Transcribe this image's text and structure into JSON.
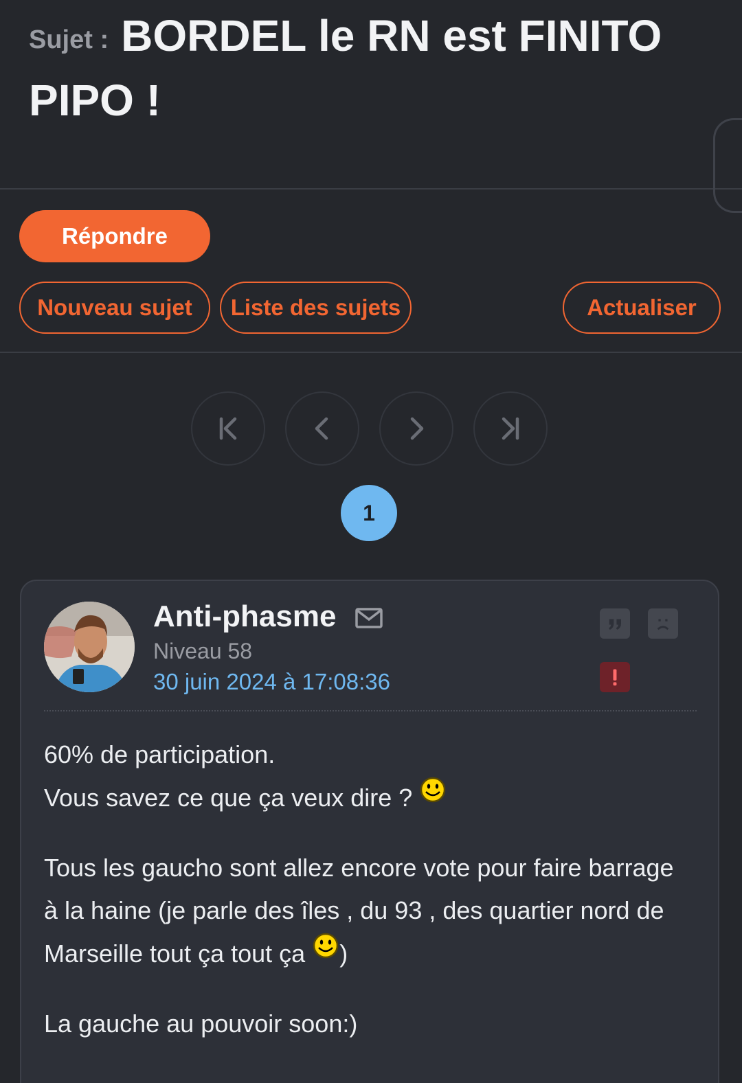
{
  "topic": {
    "prefix": "Sujet :",
    "title": "BORDEL le RN est FINITO PIPO !"
  },
  "actions": {
    "reply_label": "Répondre",
    "new_topic_label": "Nouveau sujet",
    "topic_list_label": "Liste des sujets",
    "refresh_label": "Actualiser"
  },
  "pagination": {
    "icons": [
      "first-page-icon",
      "prev-page-icon",
      "next-page-icon",
      "last-page-icon"
    ],
    "current_page": "1"
  },
  "post": {
    "author": "Anti-phasme",
    "level": "Niveau 58",
    "date": "30 juin 2024 à 17:08:36",
    "paragraphs": {
      "p1_line1": "60% de participation.",
      "p1_line2": "Vous savez ce que ça veux dire ?",
      "p2_text": "Tous les gaucho sont allez encore vote pour faire barrage à la haine (je parle des îles , du 93 , des quartier nord de Marseille tout ça tout ça",
      "p2_tail": ")",
      "p3": "La gauche au pouvoir soon:)"
    },
    "icons": [
      "mail-icon",
      "quote-icon",
      "sad-face-icon",
      "alert-icon",
      "smiley-icon"
    ]
  },
  "colors": {
    "background": "#25272c",
    "accent": "#f26632",
    "link_blue": "#6fb8f0",
    "card": "#2d3038",
    "alert_red": "#6e2229"
  }
}
